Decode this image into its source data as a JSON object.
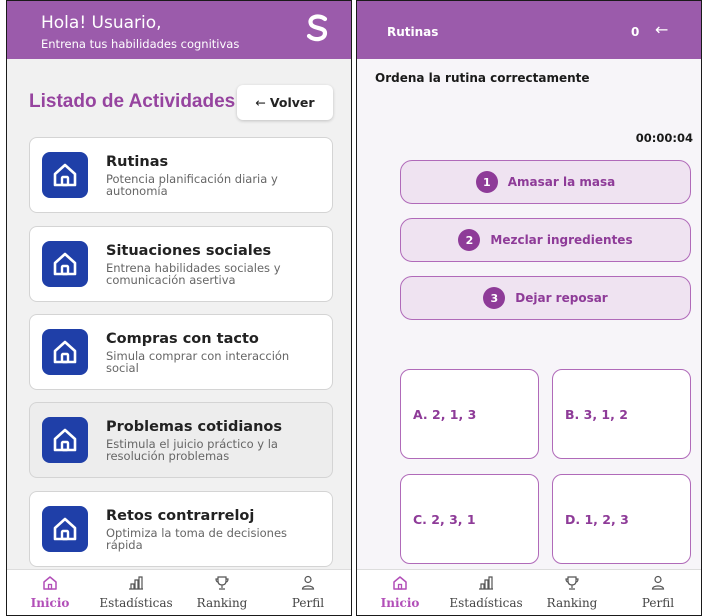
{
  "left": {
    "header": {
      "greeting": "Hola! Usuario,",
      "subtitle": "Entrena tus habilidades cognitivas",
      "logo_letter": "S"
    },
    "list_title": "Listado de Actividades",
    "back_button": {
      "arrow": "←",
      "label": "Volver"
    },
    "activities": [
      {
        "title": "Rutinas",
        "description": "Potencia planificación diaria y autonomía",
        "icon": "home-icon"
      },
      {
        "title": "Situaciones sociales",
        "description": "Entrena habilidades sociales y comunicación asertiva",
        "icon": "home-icon"
      },
      {
        "title": "Compras con tacto",
        "description": "Simula comprar con interacción social",
        "icon": "home-icon"
      },
      {
        "title": "Problemas cotidianos",
        "description": "Estimula el juicio práctico y la resolución problemas",
        "icon": "home-icon"
      },
      {
        "title": "Retos contrarreloj",
        "description": "Optimiza la toma de decisiones rápida",
        "icon": "home-icon"
      }
    ],
    "nav": [
      {
        "label": "Inicio",
        "icon": "home-outline-icon",
        "active": true
      },
      {
        "label": "Estadísticas",
        "icon": "bar-chart-icon",
        "active": false
      },
      {
        "label": "Ranking",
        "icon": "trophy-icon",
        "active": false
      },
      {
        "label": "Perfil",
        "icon": "person-icon",
        "active": false
      }
    ]
  },
  "right": {
    "header": {
      "title": "Rutinas",
      "score": "0",
      "back_arrow": "←"
    },
    "instruction": "Ordena la rutina correctamente",
    "timer": "00:00:04",
    "steps": [
      {
        "number": "1",
        "label": "Amasar la masa"
      },
      {
        "number": "2",
        "label": "Mezclar ingredientes"
      },
      {
        "number": "3",
        "label": "Dejar reposar"
      }
    ],
    "options": [
      "A. 2, 1, 3",
      "B. 3, 1, 2",
      "C. 2, 3, 1",
      "D. 1, 2, 3"
    ],
    "nav": [
      {
        "label": "Inicio",
        "icon": "home-outline-icon",
        "active": true
      },
      {
        "label": "Estadísticas",
        "icon": "bar-chart-icon",
        "active": false
      },
      {
        "label": "Ranking",
        "icon": "trophy-icon",
        "active": false
      },
      {
        "label": "Perfil",
        "icon": "person-icon",
        "active": false
      }
    ]
  },
  "colors": {
    "header": "#9b5bab",
    "accent": "#96449f",
    "icon_bg": "#1f3fa8",
    "nav_active": "#b24fb8"
  }
}
